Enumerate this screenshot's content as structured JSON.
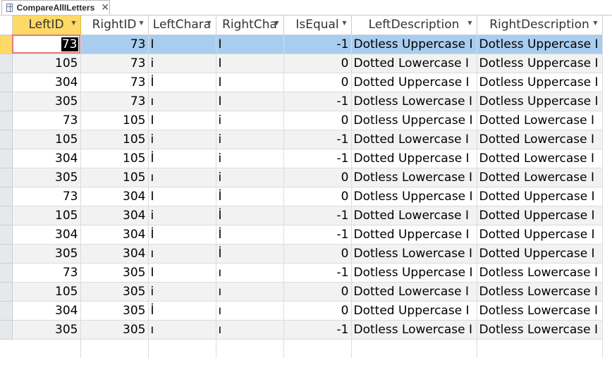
{
  "tab": {
    "title": "CompareAllILetters",
    "close_glyph": "✕"
  },
  "columns": [
    {
      "key": "LeftID",
      "label": "LeftID"
    },
    {
      "key": "RightID",
      "label": "RightID"
    },
    {
      "key": "LeftChar",
      "label": "LeftChara"
    },
    {
      "key": "RightChar",
      "label": "RightCha"
    },
    {
      "key": "IsEqual",
      "label": "IsEqual"
    },
    {
      "key": "LeftDescription",
      "label": "LeftDescription"
    },
    {
      "key": "RightDescription",
      "label": "RightDescription"
    }
  ],
  "sort_arrow_glyph": "▼",
  "rows": [
    [
      "73",
      "73",
      "I",
      "I",
      "-1",
      "Dotless Uppercase I",
      "Dotless Uppercase I"
    ],
    [
      "105",
      "73",
      "i",
      "I",
      "0",
      "Dotted Lowercase I",
      "Dotless Uppercase I"
    ],
    [
      "304",
      "73",
      "İ",
      "I",
      "0",
      "Dotted Uppercase I",
      "Dotless Uppercase I"
    ],
    [
      "305",
      "73",
      "ı",
      "I",
      "-1",
      "Dotless Lowercase I",
      "Dotless Uppercase I"
    ],
    [
      "73",
      "105",
      "I",
      "i",
      "0",
      "Dotless Uppercase I",
      "Dotted Lowercase I"
    ],
    [
      "105",
      "105",
      "i",
      "i",
      "-1",
      "Dotted Lowercase I",
      "Dotted Lowercase I"
    ],
    [
      "304",
      "105",
      "İ",
      "i",
      "-1",
      "Dotted Uppercase I",
      "Dotted Lowercase I"
    ],
    [
      "305",
      "105",
      "ı",
      "i",
      "0",
      "Dotless Lowercase I",
      "Dotted Lowercase I"
    ],
    [
      "73",
      "304",
      "I",
      "İ",
      "0",
      "Dotless Uppercase I",
      "Dotted Uppercase I"
    ],
    [
      "105",
      "304",
      "i",
      "İ",
      "-1",
      "Dotted Lowercase I",
      "Dotted Uppercase I"
    ],
    [
      "304",
      "304",
      "İ",
      "İ",
      "-1",
      "Dotted Uppercase I",
      "Dotted Uppercase I"
    ],
    [
      "305",
      "304",
      "ı",
      "İ",
      "0",
      "Dotless Lowercase I",
      "Dotted Uppercase I"
    ],
    [
      "73",
      "305",
      "I",
      "ı",
      "-1",
      "Dotless Uppercase I",
      "Dotless Lowercase I"
    ],
    [
      "105",
      "305",
      "i",
      "ı",
      "0",
      "Dotted Lowercase I",
      "Dotless Lowercase I"
    ],
    [
      "304",
      "305",
      "İ",
      "ı",
      "0",
      "Dotted Uppercase I",
      "Dotless Lowercase I"
    ],
    [
      "305",
      "305",
      "ı",
      "ı",
      "-1",
      "Dotless Lowercase I",
      "Dotless Lowercase I"
    ]
  ],
  "colors": {
    "selected_header": "#ffd966",
    "selected_row": "#a8cdef",
    "alt_row": "#f2f2f2"
  }
}
